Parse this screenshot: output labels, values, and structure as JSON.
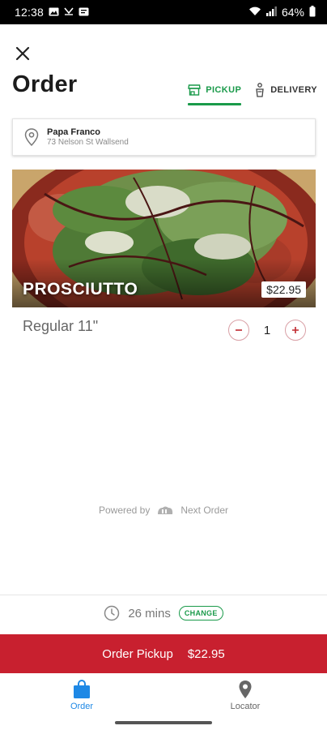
{
  "status_bar": {
    "time": "12:38",
    "battery": "64%"
  },
  "header": {
    "title": "Order",
    "close_icon": "close-icon"
  },
  "tabs": [
    {
      "label": "PICKUP",
      "icon": "store-icon",
      "active": true
    },
    {
      "label": "DELIVERY",
      "icon": "delivery-icon",
      "active": false
    }
  ],
  "location": {
    "name": "Papa Franco",
    "address": "73 Nelson St Wallsend",
    "icon": "location-pin-icon"
  },
  "product": {
    "name": "PROSCIUTTO",
    "price": "$22.95",
    "size": "Regular 11\"",
    "quantity": "1"
  },
  "powered_by": {
    "prefix": "Powered by",
    "brand": "Next Order"
  },
  "timing": {
    "duration": "26 mins",
    "change_label": "CHANGE"
  },
  "cta": {
    "label": "Order Pickup",
    "price": "$22.95"
  },
  "bottom_nav": [
    {
      "label": "Order",
      "icon": "shopping-bag-icon",
      "active": true
    },
    {
      "label": "Locator",
      "icon": "map-pin-icon",
      "active": false
    }
  ],
  "colors": {
    "brand_red": "#c8202f",
    "accent_green": "#1a9a4a",
    "nav_active_blue": "#1e88e5"
  }
}
